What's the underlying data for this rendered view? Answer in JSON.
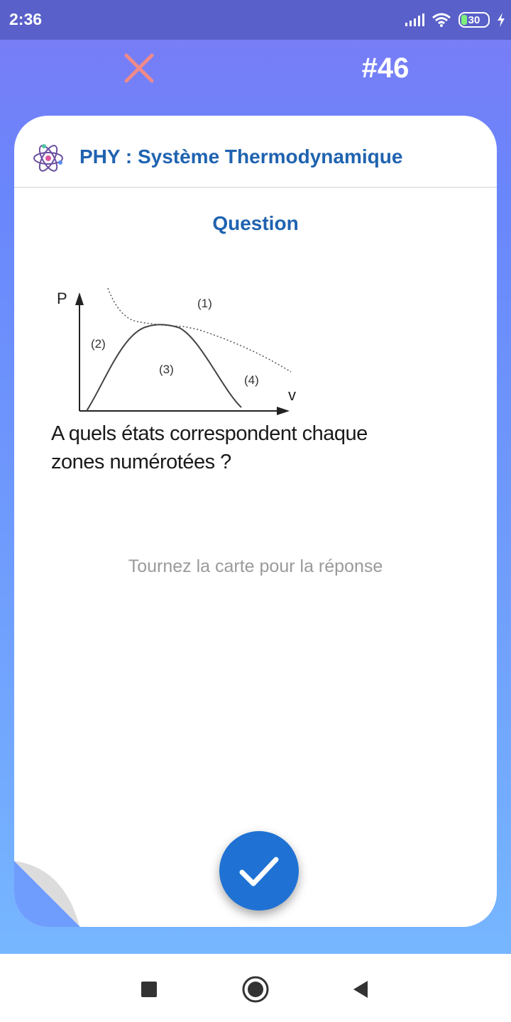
{
  "status_bar": {
    "time": "2:36",
    "battery": "30",
    "icons": [
      "signal-icon",
      "wifi-icon",
      "battery-icon",
      "charging-icon"
    ]
  },
  "toolbar": {
    "close_icon": "close-icon",
    "card_number": "#46"
  },
  "card": {
    "topic_icon": "atom-icon",
    "topic_title": "PHY : Système Thermodynamique",
    "section_heading": "Question",
    "figure": {
      "p_label": "P",
      "v_label": "v",
      "zone_labels": [
        "(1)",
        "(2)",
        "(3)",
        "(4)"
      ]
    },
    "question_line1": "A quels états correspondent chaque",
    "question_line2": "zones numérotées ?",
    "flip_hint": "Tournez la carte pour la réponse",
    "confirm_icon": "check-icon"
  },
  "nav_bar": {
    "buttons": [
      "recents-square-icon",
      "home-circle-icon",
      "back-triangle-icon"
    ]
  },
  "colors": {
    "accent": "#1f63b0",
    "fab": "#1f72d4",
    "close": "#f08a8a",
    "status_bar": "#5960c9"
  }
}
